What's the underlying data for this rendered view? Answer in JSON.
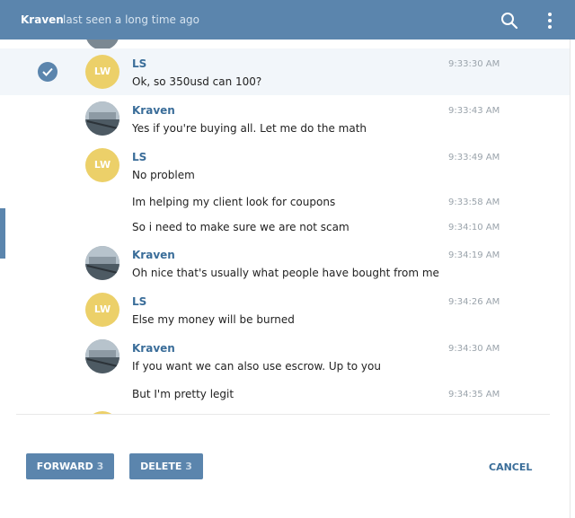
{
  "header": {
    "peer_name": "Kraven",
    "peer_status": "last seen a long time ago",
    "icons": [
      "search-icon",
      "more-vertical-icon"
    ]
  },
  "avatars": {
    "ls_initials": "LW"
  },
  "messages": [
    {
      "sender": "LS",
      "text": "Ok, so 350usd can 100?",
      "time": "9:33:30 AM",
      "selected": true,
      "avatar": "LW"
    },
    {
      "sender": "Kraven",
      "text": "Yes if you're buying all. Let me do the math",
      "time": "9:33:43 AM",
      "avatar": "photo"
    },
    {
      "sender": "LS",
      "text": "No problem",
      "time": "9:33:49 AM",
      "avatar": "LW"
    },
    {
      "sender": "",
      "text": "Im helping my client look for coupons",
      "time": "9:33:58 AM"
    },
    {
      "sender": "",
      "text": "So i need to make sure we are not scam",
      "time": "9:34:10 AM"
    },
    {
      "sender": "Kraven",
      "text": "Oh nice that's usually what people have bought from me",
      "time": "9:34:19 AM",
      "avatar": "photo"
    },
    {
      "sender": "LS",
      "text": "Else my money will be burned",
      "time": "9:34:26 AM",
      "avatar": "LW"
    },
    {
      "sender": "Kraven",
      "text": "If you want we can also use escrow. Up to you",
      "time": "9:34:30 AM",
      "avatar": "photo"
    },
    {
      "sender": "",
      "text": "But I'm pretty legit",
      "time": "9:34:35 AM"
    }
  ],
  "actions": {
    "forward_label": "FORWARD",
    "forward_count": "3",
    "delete_label": "DELETE",
    "delete_count": "3",
    "cancel_label": "CANCEL"
  },
  "colors": {
    "header_bg": "#5b85ad",
    "accent": "#3a6d99",
    "avatar_lw": "#ecd069",
    "selected_row": "#f2f6fa"
  }
}
